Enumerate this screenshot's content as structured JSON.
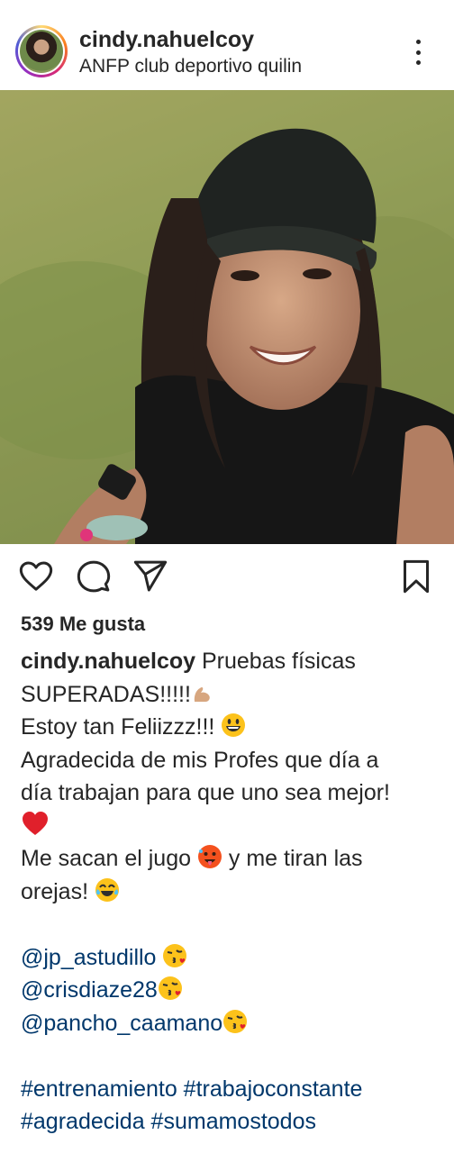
{
  "post": {
    "username": "cindy.nahuelcoy",
    "location": "ANFP club deportivo quilin",
    "likes": "539 Me gusta"
  },
  "caption": {
    "username": "cindy.nahuelcoy",
    "line1_rest": " Pruebas físicas",
    "line2": "SUPERADAS!!!!!",
    "line3": "Estoy tan Feliizzz!!! ",
    "line4": "Agradecida de mis Profes que día a",
    "line5": "día trabajan para que uno sea mejor!",
    "line7_a": "Me sacan el jugo ",
    "line7_b": " y me tiran las",
    "line8": "orejas! ",
    "mention1": "@jp_astudillo",
    "mention2": "@crisdiaze28",
    "mention3": "@pancho_caamano",
    "hashtags1": "#entrenamiento #trabajoconstante",
    "hashtags2": "#agradecida #sumamostodos"
  },
  "icons": {
    "more": "more-vertical-icon",
    "like": "heart-icon",
    "comment": "comment-icon",
    "share": "send-icon",
    "save": "bookmark-icon",
    "emoji_muscle": "flexed-biceps-icon",
    "emoji_smile": "grinning-face-icon",
    "emoji_heart": "red-heart-icon",
    "emoji_hot": "hot-face-icon",
    "emoji_laugh": "tears-of-joy-icon",
    "emoji_kiss": "kissing-heart-icon"
  },
  "colors": {
    "text": "#262626",
    "link": "#00376b",
    "heart_red": "#e0202b"
  }
}
